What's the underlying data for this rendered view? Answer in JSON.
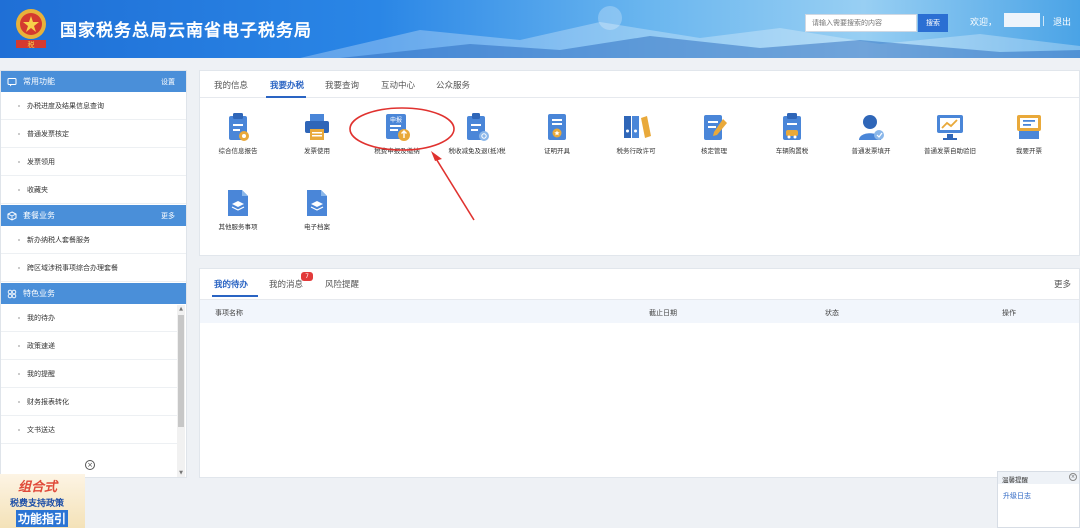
{
  "header": {
    "site_title": "国家税务总局云南省电子税务局",
    "search_placeholder": "请输入需要搜索的内容",
    "search_button": "搜索",
    "welcome": "欢迎，",
    "logout": "退出",
    "emblem_text": "税"
  },
  "sidebar": {
    "common": {
      "title": "常用功能",
      "action": "设置",
      "items": [
        "办税进度及结果信息查询",
        "普通发票核定",
        "发票领用",
        "收藏夹"
      ]
    },
    "package": {
      "title": "套餐业务",
      "action": "更多",
      "items": [
        "新办纳税人套餐服务",
        "跨区域涉税事项综合办理套餐"
      ]
    },
    "special": {
      "title": "特色业务",
      "items": [
        "我的待办",
        "政策速递",
        "我的提醒",
        "财务报表转化",
        "文书送达"
      ]
    },
    "scroll_up": "▲",
    "scroll_down": "▼"
  },
  "promo": {
    "close": "×",
    "line1": "组合式",
    "line2": "税费支持政策",
    "line3": "功能指引"
  },
  "main": {
    "tabs": [
      "我的信息",
      "我要办税",
      "我要查询",
      "互动中心",
      "公众服务"
    ],
    "services": [
      {
        "label": "综合信息报告",
        "icon": "report-icon"
      },
      {
        "label": "发票使用",
        "icon": "printer-icon"
      },
      {
        "label": "税费申报及缴纳",
        "icon": "declare-pay-icon"
      },
      {
        "label": "税收减免及退(抵)税",
        "icon": "tax-relief-icon"
      },
      {
        "label": "证明开具",
        "icon": "certificate-icon"
      },
      {
        "label": "税务行政许可",
        "icon": "binders-icon"
      },
      {
        "label": "核定管理",
        "icon": "edit-doc-icon"
      },
      {
        "label": "车辆购置税",
        "icon": "vehicle-doc-icon"
      },
      {
        "label": "普通发票填开",
        "icon": "service-agent-icon"
      },
      {
        "label": "普通发票自助验旧",
        "icon": "monitor-chart-icon"
      },
      {
        "label": "我要开票",
        "icon": "invoice-icon"
      },
      {
        "label": "其他服务事项",
        "icon": "other-doc-icon"
      },
      {
        "label": "电子档案",
        "icon": "e-archive-icon"
      }
    ],
    "declare_icon_text": "申报"
  },
  "tasks": {
    "tabs": [
      "我的待办",
      "我的消息",
      "风险提醒"
    ],
    "message_badge": "7",
    "more": "更多",
    "columns": [
      "事项名称",
      "截止日期",
      "状态",
      "操作"
    ]
  },
  "notice": {
    "title": "温馨提醒",
    "close": "×",
    "link": "升级日志"
  },
  "colors": {
    "brand_blue": "#2a64c3",
    "sidebar_header": "#4a8fd9",
    "annotation_red": "#e0322f"
  }
}
